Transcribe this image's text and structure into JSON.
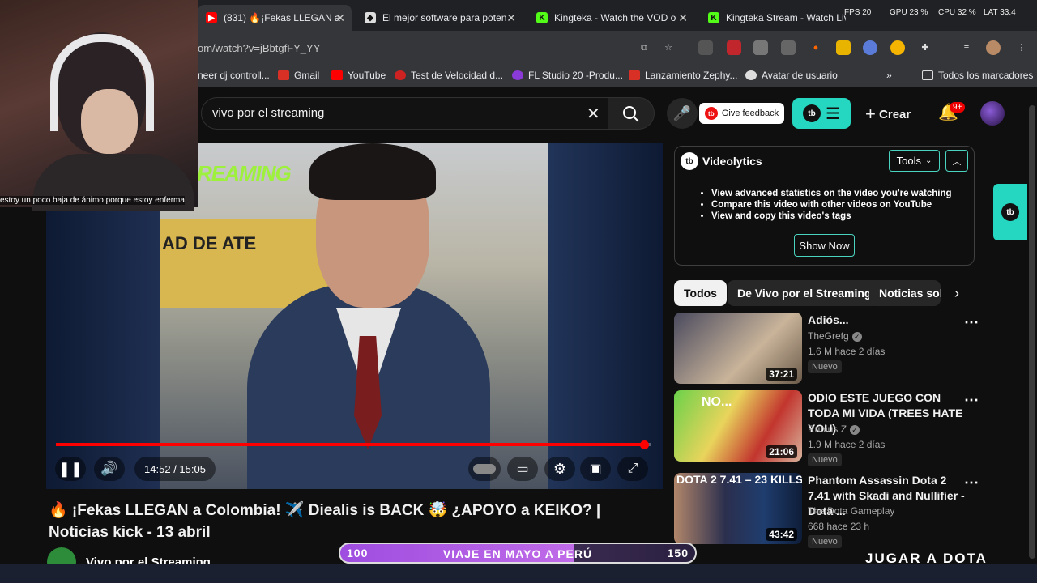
{
  "browser": {
    "tabs": [
      {
        "title": "(831) 🔥¡Fekas LLEGAN a",
        "favicon": "youtube",
        "active": true
      },
      {
        "title": "El mejor software para poten",
        "favicon": "shield"
      },
      {
        "title": "Kingteka - Watch the VOD o",
        "favicon": "kick"
      },
      {
        "title": "Kingteka Stream - Watch Live",
        "favicon": "kick"
      }
    ],
    "perf_stats": {
      "fps_label": "FPS",
      "fps": "20",
      "gpu_label": "GPU",
      "gpu": "23",
      "cpu_label": "CPU",
      "cpu": "32",
      "lat_label": "LAT",
      "lat": "33.4"
    },
    "url": "om/watch?v=jBbtgfFY_YY",
    "bookmarks": [
      "neer dj controll...",
      "Gmail",
      "YouTube",
      "Test de Velocidad d...",
      "FL Studio 20 -Produ...",
      "Lanzamiento Zephy...",
      "Avatar de usuario"
    ],
    "bookmarks_folder": "Todos los marcadores"
  },
  "youtube": {
    "search_query": "vivo por el streaming",
    "give_feedback": "Give feedback",
    "create": "Crear",
    "notifications": "9+",
    "player": {
      "time": "14:52 / 15:05",
      "progress": 0.988,
      "overlay_text_streaming": "REAMING",
      "overlay_text_building": "AD DE ATE"
    },
    "video_title": "🔥 ¡Fekas LLEGAN a Colombia! ✈️ Diealis is BACK 🤯 ¿APOYO a KEIKO? | Noticias kick - 13 abril",
    "channel": "Vivo por el Streaming"
  },
  "videolytics": {
    "title": "Videolytics",
    "tools": "Tools",
    "items": [
      "View advanced statistics on the video you're watching",
      "Compare this video with other videos on YouTube",
      "View and copy this video's tags"
    ],
    "show_now": "Show Now"
  },
  "chips": [
    "Todos",
    "De Vivo por el Streaming",
    "Noticias sob"
  ],
  "recommendations": [
    {
      "title": "Adiós...",
      "channel": "TheGrefg",
      "views": "1.6 M",
      "age": "hace 2 días",
      "badge": "Nuevo",
      "duration": "37:21"
    },
    {
      "title": "ODIO ESTE JUEGO CON TODA MI VIDA (TREES HATE YOU)",
      "channel": "Rubius Z",
      "views": "1.9 M",
      "age": "hace 2 días",
      "badge": "Nuevo",
      "duration": "21:06",
      "thumb_text": "NO..."
    },
    {
      "title": "Phantom Assassin Dota 2 7.41 with Skadi and Nullifier - Dota ...",
      "channel": "The Dota Gameplay",
      "views": "668",
      "age": "hace 23 h",
      "badge": "Nuevo",
      "duration": "43:42",
      "thumb_text": "DOTA 2 7.41 – 23 KILLS"
    }
  ],
  "stream_overlay": {
    "webcam_caption": "estoy un poco baja de ánimo porque estoy enferma",
    "goal_start": "100",
    "goal_label": "VIAJE EN MAYO A PERÚ",
    "goal_end": "150",
    "goal_progress": 0.66,
    "bottom_text": "JUGAR A DOTA"
  },
  "colors": {
    "accent": "#25d7c0",
    "progress": "#ff0000",
    "background": "#0f0f0f"
  }
}
